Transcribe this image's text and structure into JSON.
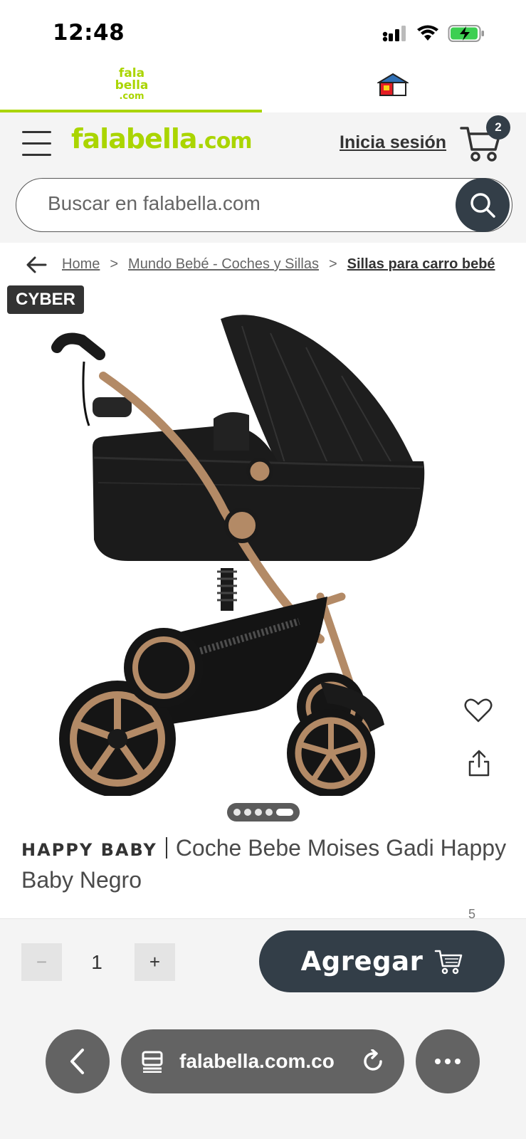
{
  "status": {
    "time": "12:48",
    "icons": [
      "signal-icon",
      "wifi-icon",
      "battery-charging-icon"
    ]
  },
  "brand_tabs": {
    "falabella_lines": [
      "fala",
      "bella",
      ".com"
    ],
    "home_icon": "homecenter-house-icon"
  },
  "header": {
    "logo_text": "falabella",
    "logo_suffix": ".com",
    "login_label": "Inicia sesión",
    "cart_count": "2",
    "search_placeholder": "Buscar en falabella.com"
  },
  "breadcrumb": {
    "items": [
      "Home",
      "Mundo Bebé - Coches y Sillas",
      "Sillas para carro bebé"
    ],
    "separator": ">"
  },
  "product": {
    "badge": "CYBER",
    "brand": "HAPPY BABY",
    "name": "Coche Bebe Moises Gadi Happy Baby Negro",
    "rating_count": "5",
    "image_description_icon": "stroller-image"
  },
  "carousel": {
    "total": 5,
    "active_index": 4
  },
  "buy": {
    "quantity": "1",
    "minus_label": "−",
    "plus_label": "+",
    "add_label": "Agregar"
  },
  "browser": {
    "url": "falabella.com.co"
  },
  "colors": {
    "brand_green": "#aad500",
    "primary_dark": "#333e48",
    "browser_gray": "#636363"
  }
}
